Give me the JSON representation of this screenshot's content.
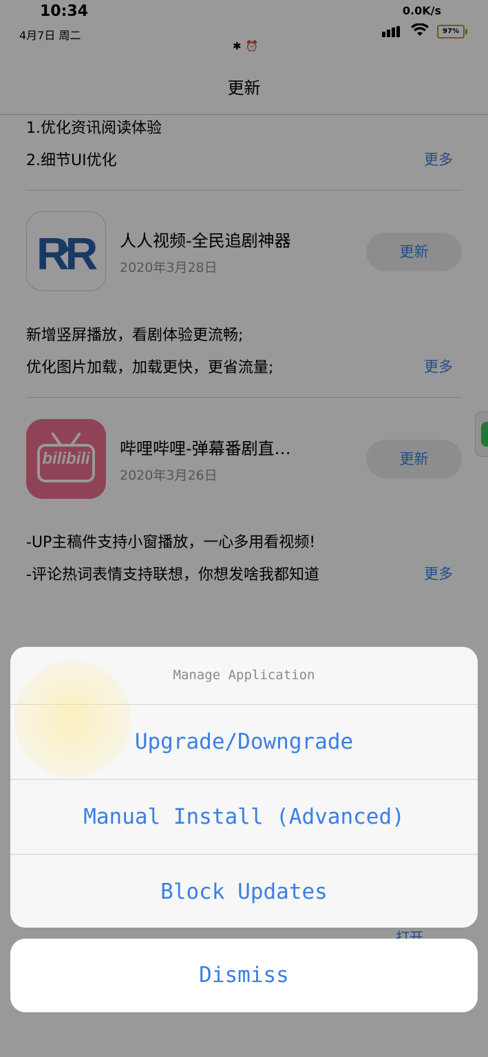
{
  "status": {
    "time": "10:34",
    "date": "4月7日  周二",
    "network_speed": "0.0K/s",
    "battery": "97%",
    "bluetooth_icon": "✱",
    "alarm_icon": "⏰",
    "wifi_icon": "wifi-icon"
  },
  "nav": {
    "title": "更新"
  },
  "top_notes": [
    "1.优化资讯阅读体验",
    "2.细节UI优化"
  ],
  "more_label": "更多",
  "apps": [
    {
      "icon_text": "R/R",
      "name": "人人视频-全民追剧神器",
      "date": "2020年3月28日",
      "button": "更新",
      "notes": [
        "新增竖屏播放，看剧体验更流畅;",
        "优化图片加载，加载更快，更省流量;"
      ]
    },
    {
      "icon_text": "bilibili",
      "name": "哔哩哔哩-弹幕番剧直…",
      "date": "2020年3月26日",
      "button": "更新",
      "notes": [
        "-UP主稿件支持小窗播放，一心多用看视频!",
        "-评论热词表情支持联想，你想发啥我都知道"
      ]
    }
  ],
  "peek_button": "打开",
  "action_sheet": {
    "title": "Manage Application",
    "options": [
      "Upgrade/Downgrade",
      "Manual Install (Advanced)",
      "Block Updates"
    ],
    "dismiss": "Dismiss"
  },
  "colors": {
    "accent": "#3b7fe6",
    "overlay": "rgba(0,0,0,0.40)",
    "bili_pink": "#f0708f",
    "rr_blue": "#2a5fa8"
  }
}
